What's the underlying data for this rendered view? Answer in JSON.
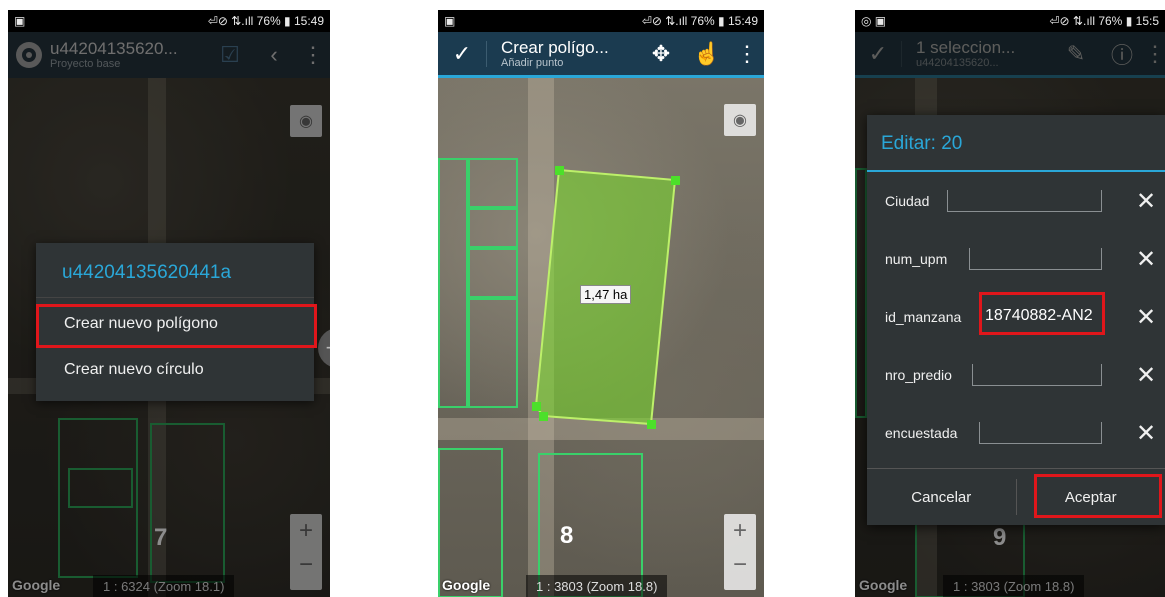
{
  "phone1": {
    "status": {
      "time": "15:49",
      "battery": "76%",
      "signal": "⏎⊘ ⇅.ıll"
    },
    "header": {
      "title": "u44204135620...",
      "subtitle": "Proyecto base"
    },
    "menu": {
      "title": "u44204135620441a",
      "items": [
        "Crear nuevo polígono",
        "Crear nuevo círculo"
      ]
    },
    "step": "7",
    "google": "Google",
    "scale": "1 : 6324 (Zoom 18.1)"
  },
  "phone2": {
    "status": {
      "time": "15:49",
      "battery": "76%",
      "signal": "⏎⊘ ⇅.ıll"
    },
    "header": {
      "title": "Crear polígo...",
      "subtitle": "Añadir punto"
    },
    "area_label": "1,47 ha",
    "step": "8",
    "google": "Google",
    "scale": "1 : 3803 (Zoom 18.8)"
  },
  "phone3": {
    "status": {
      "time": "15:5",
      "battery": "76%",
      "signal": "⏎⊘ ⇅.ıll"
    },
    "header": {
      "title": "1 seleccion...",
      "subtitle": "u44204135620..."
    },
    "dialog": {
      "title": "Editar: 20",
      "fields": [
        {
          "label": "Ciudad",
          "value": ""
        },
        {
          "label": "num_upm",
          "value": ""
        },
        {
          "label": "id_manzana",
          "value": "18740882-AN2"
        },
        {
          "label": "nro_predio",
          "value": ""
        },
        {
          "label": "encuestada",
          "value": ""
        }
      ],
      "cancel": "Cancelar",
      "accept": "Aceptar"
    },
    "step": "9",
    "google": "Google",
    "scale": "1 : 3803 (Zoom 18.8)"
  },
  "colors": {
    "accent": "#2aa7d8",
    "highlight": "#e0161b",
    "parcel": "#3ad06a"
  }
}
